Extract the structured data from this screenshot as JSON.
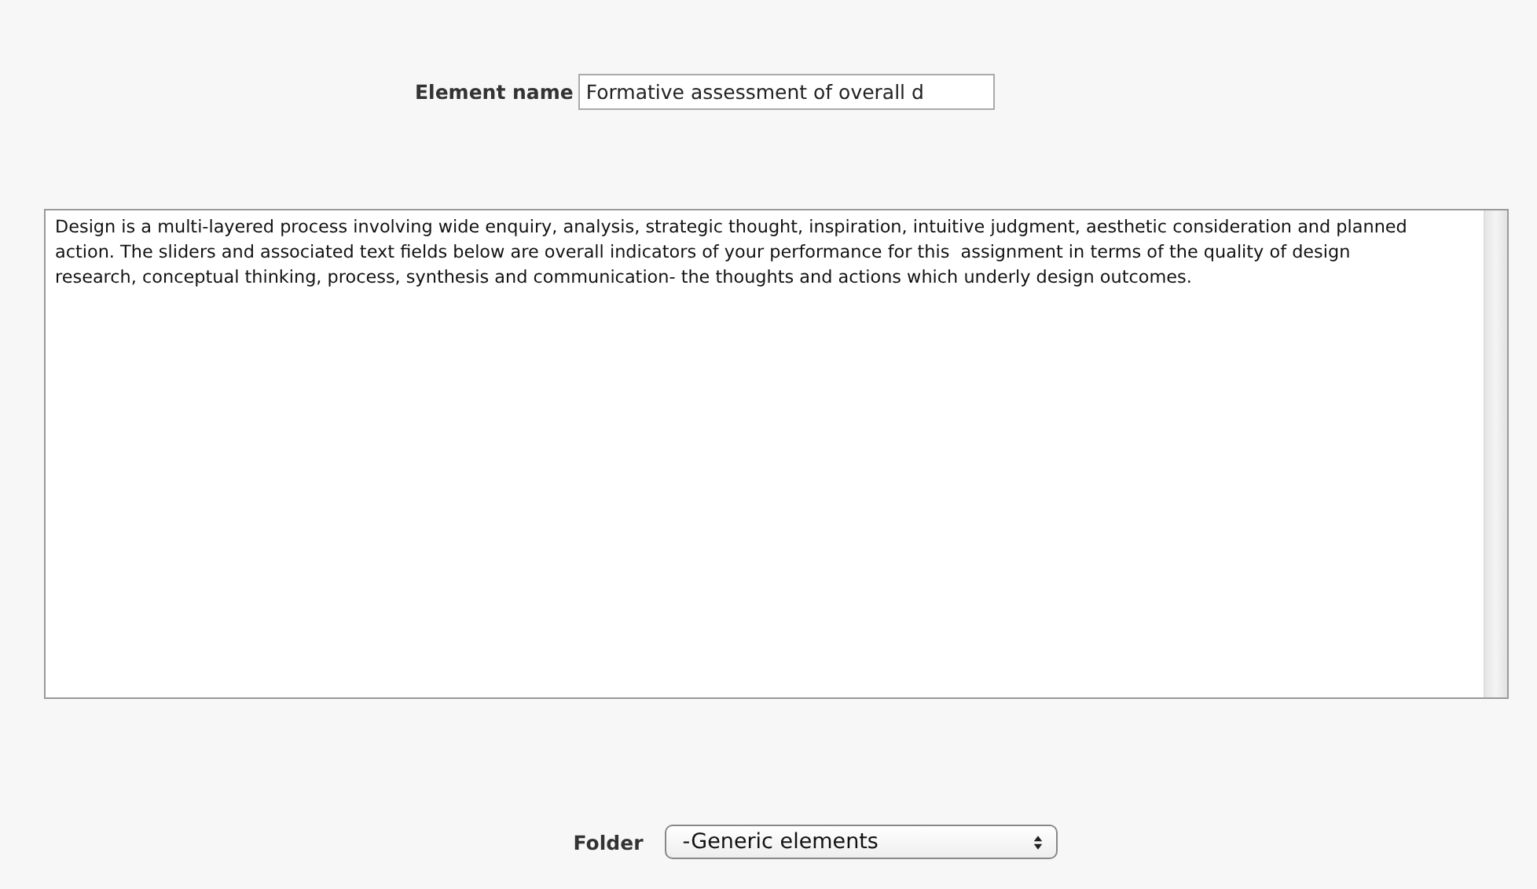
{
  "element_name": {
    "label": "Element name",
    "value": "Formative assessment of overall d"
  },
  "description": {
    "value": "Design is a multi-layered process involving wide enquiry, analysis, strategic thought, inspiration, intuitive judgment, aesthetic consideration and planned action. The sliders and associated text fields below are overall indicators of your performance for this  assignment in terms of the quality of design research, conceptual thinking, process, synthesis and communication- the thoughts and actions which underly design outcomes."
  },
  "folder": {
    "label": "Folder",
    "value": "-Generic elements"
  }
}
